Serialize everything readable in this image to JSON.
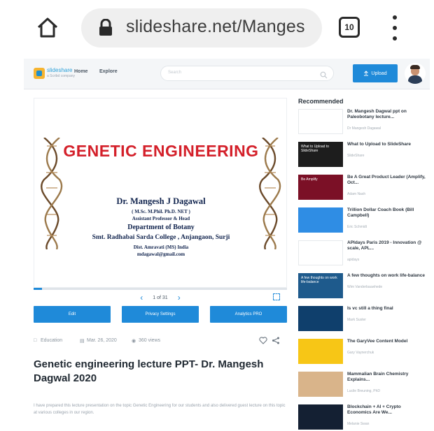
{
  "browser": {
    "url": "slideshare.net/Manges",
    "tab_count": "10"
  },
  "topnav": {
    "logo_text": "slideshare",
    "logo_sub": "a Scribd company",
    "nav_home": "Home",
    "nav_explore": "Explore",
    "search_placeholder": "Search",
    "upload_label": "Upload"
  },
  "slide": {
    "title": "GENETIC ENGINEERING",
    "author_name": "Dr. Mangesh J Dagawal",
    "author_degrees": "( M.Sc. M.Phil. Ph.D. NET )",
    "author_position": "Assistant Professor & Head",
    "author_department": "Department of Botany",
    "author_college": "Smt. Radhabai Sarda College , Anjangaon, Surji",
    "author_district": "Dist. Amravati (MS) India",
    "author_email": "mdagawal@gmail.com",
    "pager": "1 of 31",
    "progress_fraction": 0.032
  },
  "actions": {
    "edit": "Edit",
    "privacy": "Privacy Settings",
    "analytics": "Analytics PRO"
  },
  "meta": {
    "category": "Education",
    "date": "Mar. 26, 2020",
    "views": "360 views"
  },
  "document": {
    "title": "Genetic engineering lecture PPT- Dr. Mangesh Dagwal 2020",
    "description": "I have prepared this lecture presentation on the topic Genetic Engineering for our students and also delivered guest lecture on this topic at various colleges in our region."
  },
  "recommended": {
    "heading": "Recommended",
    "items": [
      {
        "title": "Dr. Mangesh Dagwal ppt on Paleobotany lecture...",
        "author": "Dr Mangesh Dagawal",
        "thumb_color": "#ffffff",
        "thumb_text": ""
      },
      {
        "title": "What to Upload to SlideShare",
        "author": "SlideShare",
        "thumb_color": "#1d1d1d",
        "thumb_text": "What to Upload to SlideShare"
      },
      {
        "title": "Be A Great Product Leader (Amplify, Oct...",
        "author": "Adam Nash",
        "thumb_color": "#7b1026",
        "thumb_text": "Be Amplify"
      },
      {
        "title": "Trillion Dollar Coach Book (Bill Campbell)",
        "author": "Eric Schmidt",
        "thumb_color": "#2f8de4",
        "thumb_text": ""
      },
      {
        "title": "APIdays Paris 2019 - Innovation @ scale, APL...",
        "author": "apidays",
        "thumb_color": "#ffffff",
        "thumb_text": ""
      },
      {
        "title": "A few thoughts on work life-balance",
        "author": "Wim Vanderbauwhede",
        "thumb_color": "#1e5a8c",
        "thumb_text": "A few thoughts on work life-balance"
      },
      {
        "title": "Is vc still a thing final",
        "author": "Mark Suster",
        "thumb_color": "#0f3f6c",
        "thumb_text": ""
      },
      {
        "title": "The GaryVee Content Model",
        "author": "Gary Vaynerchuk",
        "thumb_color": "#f7c616",
        "thumb_text": ""
      },
      {
        "title": "Mammalian Brain Chemistry Explains...",
        "author": "Lucile Breuning, PhD",
        "thumb_color": "#d9b48a",
        "thumb_text": ""
      },
      {
        "title": "Blockchain + AI + Crypto Economics Are We...",
        "author": "Melanie Swan",
        "thumb_color": "#142033",
        "thumb_text": ""
      }
    ]
  }
}
